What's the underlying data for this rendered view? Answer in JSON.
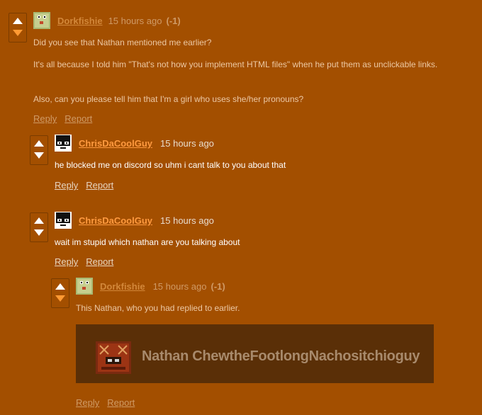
{
  "comments": [
    {
      "username": "Dorkfishie",
      "time": "15 hours ago",
      "score": "(-1)",
      "paragraphs": [
        "Did you see that Nathan mentioned me earlier?",
        "It's all because I told him \"That's not how you implement HTML files\" when he put them as unclickable links.",
        "Also, can you please tell him that I'm a girl who uses she/her pronouns?"
      ],
      "reply_label": "Reply",
      "report_label": "Report"
    },
    {
      "username": "ChrisDaCoolGuy",
      "time": "15 hours ago",
      "text": "he blocked me on discord so uhm i cant talk to you about that",
      "reply_label": "Reply",
      "report_label": "Report"
    },
    {
      "username": "ChrisDaCoolGuy",
      "time": "15 hours ago",
      "text": "wait im stupid which nathan are you talking about",
      "reply_label": "Reply",
      "report_label": "Report"
    },
    {
      "username": "Dorkfishie",
      "time": "15 hours ago",
      "score": "(-1)",
      "text": "This Nathan, who you had replied to earlier.",
      "embed_title": "Nathan ChewtheFootlongNachositchioguy",
      "reply_label": "Reply",
      "report_label": "Report"
    }
  ],
  "colors": {
    "background": "#a34f00",
    "downvoted_arrow": "#ff9a33",
    "username_dim": "#d2873a",
    "username_bright": "#ff9a40",
    "embed_background": "#5a2f07"
  },
  "icons": {
    "upvote": "upvote-arrow-icon",
    "downvote": "downvote-arrow-icon",
    "avatar_frog": "frog-avatar",
    "avatar_glasses": "glasses-face-avatar"
  }
}
